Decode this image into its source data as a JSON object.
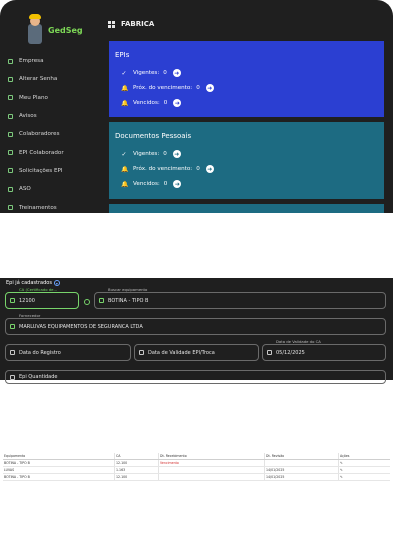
{
  "app": {
    "name": "GedSeg",
    "accent": "#7ed957"
  },
  "sidebar": {
    "items": [
      {
        "label": "Empresa"
      },
      {
        "label": "Alterar Senha"
      },
      {
        "label": "Meu Plano"
      },
      {
        "label": "Avisos"
      },
      {
        "label": "Colaboradores"
      },
      {
        "label": "EPI Colaborador"
      },
      {
        "label": "Solicitações EPI"
      },
      {
        "label": "ASO"
      },
      {
        "label": "Treinamentos"
      }
    ]
  },
  "header": {
    "title": "FABRICA",
    "icon": "grid-icon"
  },
  "cards": [
    {
      "title": "EPIs",
      "color": "#2b3fd2",
      "rows": [
        {
          "label": "Vigentes:",
          "value": "0",
          "icon": "check-icon"
        },
        {
          "label": "Próx. do vencimento:",
          "value": "0",
          "icon": "bell-icon"
        },
        {
          "label": "Vencidos:",
          "value": "0",
          "icon": "bell-icon"
        }
      ]
    },
    {
      "title": "Documentos Pessoais",
      "color": "#1d6b82",
      "rows": [
        {
          "label": "Vigentes:",
          "value": "0",
          "icon": "check-icon"
        },
        {
          "label": "Próx. do vencimento:",
          "value": "0",
          "icon": "bell-icon"
        },
        {
          "label": "Vencidos:",
          "value": "0",
          "icon": "bell-icon"
        }
      ]
    }
  ],
  "form": {
    "section_title": "Epi já cadastrados",
    "ca_label": "CA (Certificado de...",
    "ca_value": "12100",
    "equip_label": "Buscar equipamento",
    "equip_value": "BOTINA - TIPO B",
    "fornecedor_label": "Fornecedor",
    "fornecedor_value": "MARLUVAS EQUIPAMENTOS DE SEGURANCA LTDA",
    "data_registro_placeholder": "Data do Registro",
    "data_validade_epi_placeholder": "Data de Validade EPI/Troca",
    "data_validade_ca_label": "Data de Validade do CA",
    "data_validade_ca_value": "05/12/2025",
    "quantidade_placeholder": "Epi Quantidade"
  },
  "table": {
    "headers": [
      "Equipamento",
      "CA",
      "Dt. Recebimento",
      "Dt. Revisão",
      "Ações"
    ],
    "rows": [
      {
        "equipamento": "BOTINA - TIPO B",
        "ca": "12.100",
        "recebimento": "Vencimento",
        "revisao": "",
        "acoes": ""
      },
      {
        "equipamento": "LUVAS",
        "ca": "1.163",
        "recebimento": "",
        "revisao": "14/01/2025",
        "acoes": ""
      },
      {
        "equipamento": "BOTINA - TIPO B",
        "ca": "12.100",
        "recebimento": "",
        "revisao": "14/01/2025",
        "acoes": ""
      }
    ]
  }
}
